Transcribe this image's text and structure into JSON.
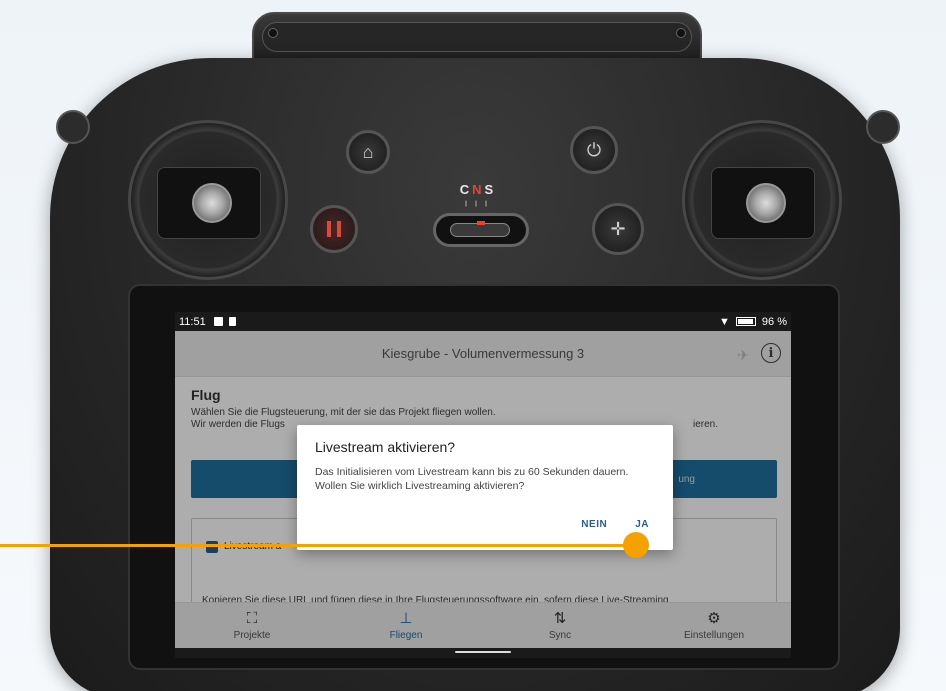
{
  "device": {
    "mode_label_c": "C",
    "mode_label_n": "N",
    "mode_label_s": "S",
    "mode_ticks": "╷╷╷"
  },
  "status_bar": {
    "time": "11:51",
    "battery": "96 %"
  },
  "header": {
    "title": "Kiesgrube - Volumenvermessung 3"
  },
  "content": {
    "section_title": "Flug",
    "desc_line1": "Wählen Sie die Flugsteuerung, mit der sie das Projekt fliegen wollen.",
    "desc_line2_start": "Wir werden die Flugs",
    "desc_line2_end": "ieren.",
    "primary_button_partial": "ung",
    "checkbox_partial": "Livestream a",
    "copy_text": "Kopieren Sie diese URL und fügen diese in Ihre Flugsteuerungssoftware ein, sofern diese Live-Streaming"
  },
  "dialog": {
    "title": "Livestream aktivieren?",
    "message": "Das Initialisieren vom Livestream kann bis zu 60 Sekunden dauern. Wollen Sie wirklich Livestreaming aktivieren?",
    "cancel_label": "NEIN",
    "confirm_label": "JA"
  },
  "bottom_nav": {
    "items": [
      {
        "label": "Projekte",
        "icon": "sitemap-icon",
        "glyph": "⛶",
        "active": false
      },
      {
        "label": "Fliegen",
        "icon": "drone-icon",
        "glyph": "⊥",
        "active": true
      },
      {
        "label": "Sync",
        "icon": "sync-icon",
        "glyph": "⇅",
        "active": false
      },
      {
        "label": "Einstellungen",
        "icon": "gears-icon",
        "glyph": "⚙",
        "active": false
      }
    ]
  },
  "colors": {
    "primary": "#1f6f9e",
    "accent_callout": "#f5a100",
    "dialog_button": "#2a5f87"
  }
}
